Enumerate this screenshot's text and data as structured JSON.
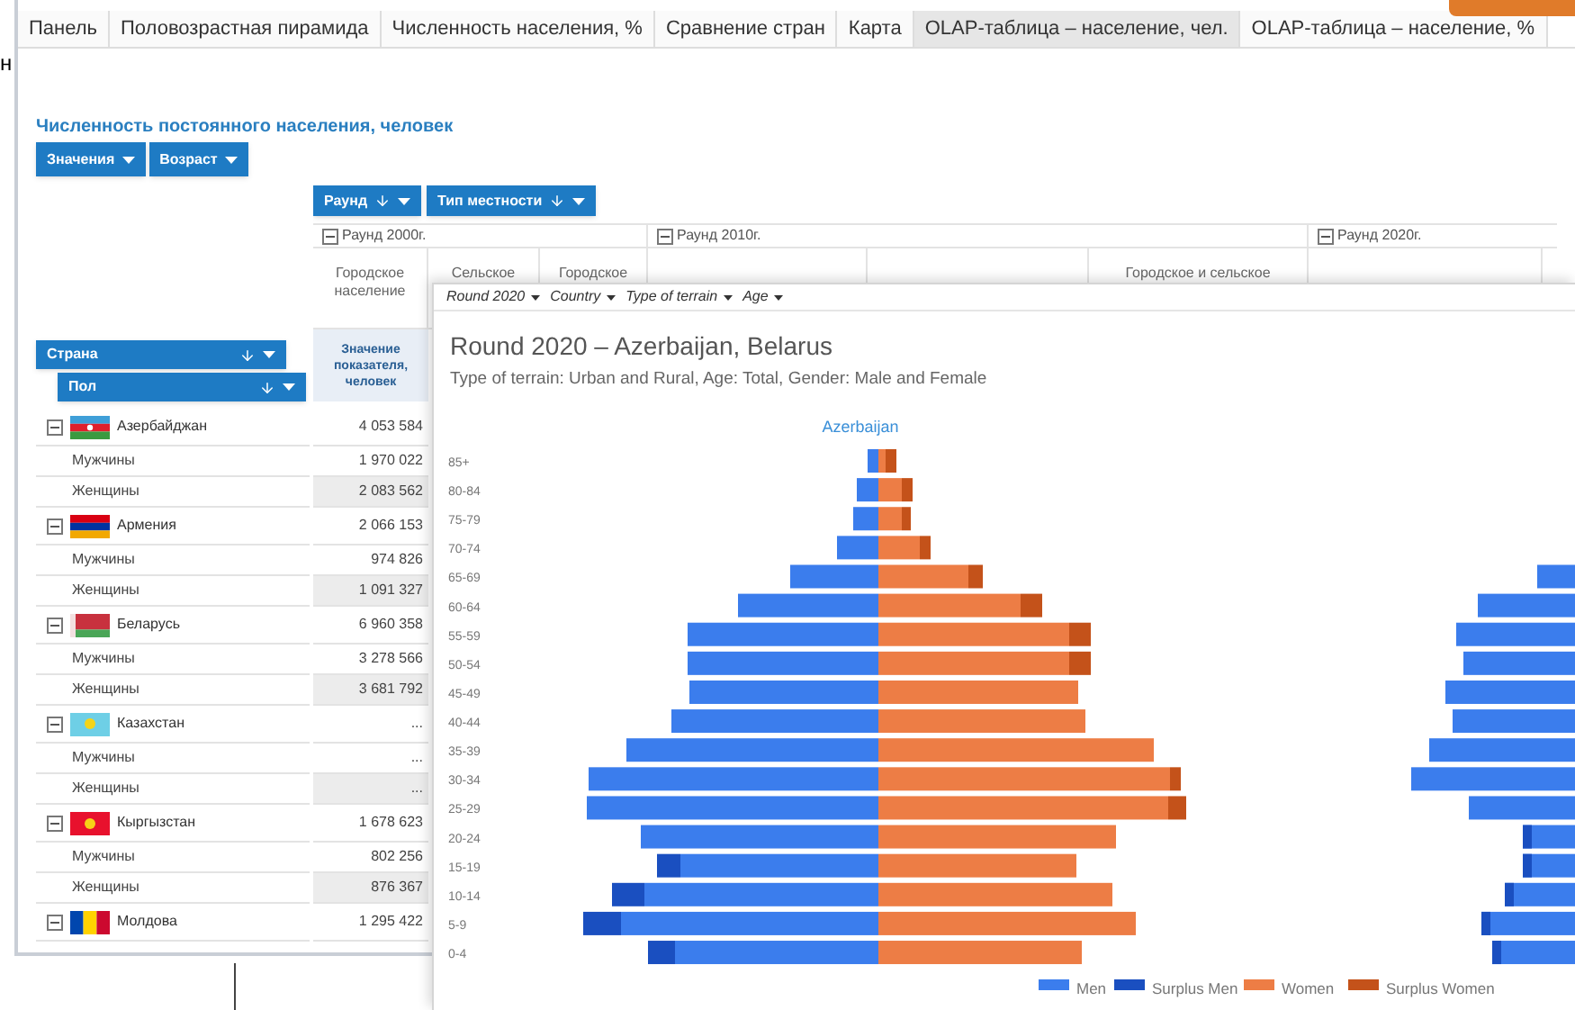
{
  "corner_text": "н",
  "tabs": [
    {
      "label": "Панель",
      "selected": false
    },
    {
      "label": "Половозрастная пирамида",
      "selected": false
    },
    {
      "label": "Численность населения, %",
      "selected": false
    },
    {
      "label": "Сравнение стран",
      "selected": false
    },
    {
      "label": "Карта",
      "selected": false
    },
    {
      "label": "OLAP-таблица – население, чел.",
      "selected": true
    },
    {
      "label": "OLAP-таблица – население, %",
      "selected": false
    }
  ],
  "report": {
    "title": "Численность постоянного населения, человек",
    "filter_buttons": [
      {
        "label": "Значения",
        "sorted": false
      },
      {
        "label": "Возраст",
        "sorted": false
      }
    ],
    "column_buttons": [
      {
        "label": "Раунд",
        "sorted": true
      },
      {
        "label": "Тип местности",
        "sorted": true
      }
    ],
    "row_buttons": [
      {
        "label": "Страна",
        "sorted": true
      },
      {
        "label": "Пол",
        "sorted": true
      }
    ],
    "column_groups": [
      {
        "label": "Раунд 2000г.",
        "expanded": true,
        "columns": [
          "Городское население",
          "Сельское",
          "Городское"
        ]
      },
      {
        "label": "Раунд 2010г.",
        "expanded": true,
        "columns": [
          "",
          "",
          "Городское и сельское"
        ]
      },
      {
        "label": "Раунд 2020г.",
        "expanded": true,
        "columns": [
          "",
          ""
        ]
      }
    ],
    "measure": "Значение показателя, человек",
    "rows": [
      {
        "name": "Азербайджан",
        "expanded": true,
        "value": "4 053 584",
        "children": [
          {
            "name": "Мужчины",
            "value": "1 970 022"
          },
          {
            "name": "Женщины",
            "value": "2 083 562"
          }
        ]
      },
      {
        "name": "Армения",
        "expanded": true,
        "value": "2 066 153",
        "children": [
          {
            "name": "Мужчины",
            "value": "974 826"
          },
          {
            "name": "Женщины",
            "value": "1 091 327"
          }
        ]
      },
      {
        "name": "Беларусь",
        "expanded": true,
        "value": "6 960 358",
        "children": [
          {
            "name": "Мужчины",
            "value": "3 278 566"
          },
          {
            "name": "Женщины",
            "value": "3 681 792"
          }
        ]
      },
      {
        "name": "Казахстан",
        "expanded": true,
        "value": "...",
        "children": [
          {
            "name": "Мужчины",
            "value": "..."
          },
          {
            "name": "Женщины",
            "value": "..."
          }
        ]
      },
      {
        "name": "Кыргызстан",
        "expanded": true,
        "value": "1 678 623",
        "children": [
          {
            "name": "Мужчины",
            "value": "802 256"
          },
          {
            "name": "Женщины",
            "value": "876 367"
          }
        ]
      },
      {
        "name": "Молдова",
        "expanded": true,
        "value": "1 295 422",
        "children": []
      }
    ]
  },
  "chart_window": {
    "filters": [
      "Round 2020",
      "Country",
      "Type of terrain",
      "Age"
    ],
    "title": "Round 2020 – Azerbaijan, Belarus",
    "subtitle": "Type of terrain: Urban and Rural, Age: Total, Gender: Male and Female",
    "panel_title": "Azerbaijan",
    "age_groups": [
      "85+",
      "80-84",
      "75-79",
      "70-74",
      "65-69",
      "60-64",
      "55-59",
      "50-54",
      "45-49",
      "40-44",
      "35-39",
      "30-34",
      "25-29",
      "20-24",
      "15-19",
      "10-14",
      "5-9",
      "0-4"
    ],
    "legend": [
      {
        "label": "Men",
        "color": "#3b7ded"
      },
      {
        "label": "Surplus Men",
        "color": "#1a4fc0"
      },
      {
        "label": "Women",
        "color": "#ed7d45"
      },
      {
        "label": "Surplus Women",
        "color": "#c4521a"
      }
    ]
  }
}
